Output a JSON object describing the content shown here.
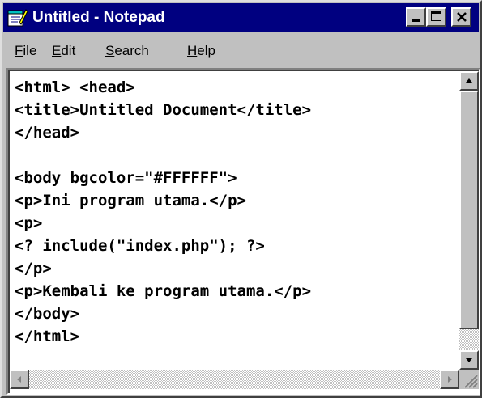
{
  "window": {
    "title": "Untitled - Notepad",
    "icon": "notepad-icon",
    "accent_color": "#000080"
  },
  "menu": [
    {
      "label": "File",
      "mnemonic": "F",
      "rest": "ile"
    },
    {
      "label": "Edit",
      "mnemonic": "E",
      "rest": "dit"
    },
    {
      "label": "Search",
      "mnemonic": "S",
      "rest": "earch"
    },
    {
      "label": "Help",
      "mnemonic": "H",
      "rest": "elp"
    }
  ],
  "editor": {
    "lines": [
      "<html> <head>",
      "<title>Untitled Document</title>",
      "</head>",
      "",
      "<body bgcolor=\"#FFFFFF\">",
      "<p>Ini program utama.</p>",
      "<p>",
      "<? include(\"index.php\"); ?>",
      "</p>",
      "<p>Kembali ke program utama.</p>",
      "</body>",
      "</html>"
    ]
  }
}
